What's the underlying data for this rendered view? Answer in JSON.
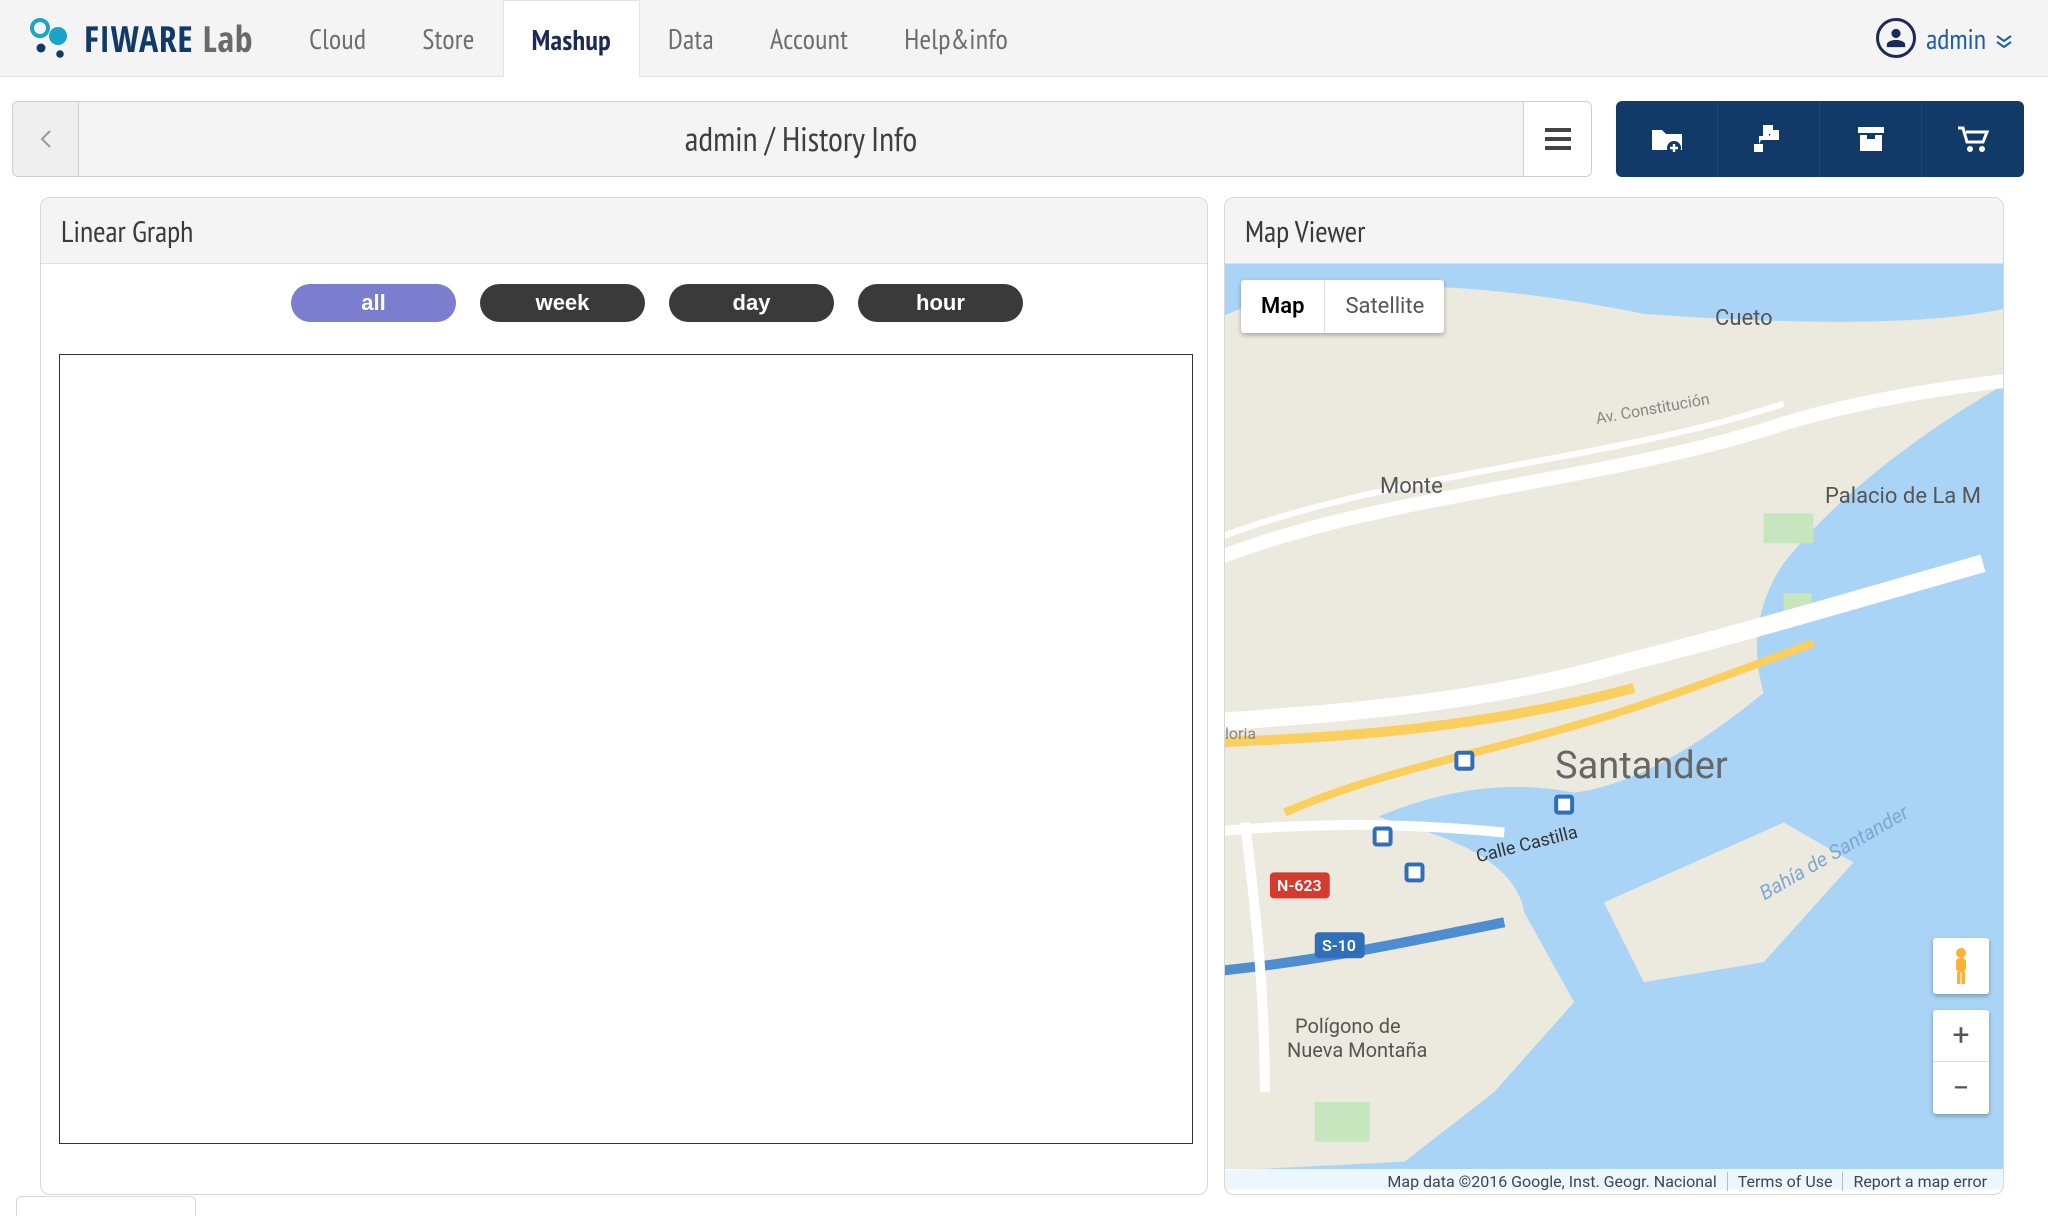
{
  "brand": {
    "name_strong": "FIWARE",
    "name_light": " Lab"
  },
  "nav": {
    "items": [
      {
        "label": "Cloud",
        "active": false
      },
      {
        "label": "Store",
        "active": false
      },
      {
        "label": "Mashup",
        "active": true
      },
      {
        "label": "Data",
        "active": false
      },
      {
        "label": "Account",
        "active": false
      },
      {
        "label": "Help&info",
        "active": false
      }
    ]
  },
  "user": {
    "name": "admin"
  },
  "breadcrumb": {
    "title": "admin / History Info"
  },
  "toolbar_icons": [
    "add-folder-icon",
    "puzzle-icon",
    "archive-icon",
    "cart-icon"
  ],
  "panels": {
    "linear_graph": {
      "title": "Linear Graph",
      "ranges": [
        {
          "label": "all",
          "active": true
        },
        {
          "label": "week",
          "active": false
        },
        {
          "label": "day",
          "active": false
        },
        {
          "label": "hour",
          "active": false
        }
      ]
    },
    "map_viewer": {
      "title": "Map Viewer",
      "types": [
        {
          "label": "Map",
          "active": true
        },
        {
          "label": "Satellite",
          "active": false
        }
      ],
      "labels": {
        "city": "Santander",
        "cueto": "Cueto",
        "monte": "Monte",
        "palacio": "Palacio de La M",
        "poligono1": "Polígono de",
        "poligono2": "Nueva Montaña",
        "constitucion": "Av. Constitución",
        "castilla": "Calle Castilla",
        "oria": "loria",
        "n623": "N-623",
        "s10": "S-10",
        "sea": "Bahía de Santander"
      },
      "attribution": {
        "data": "Map data ©2016 Google, Inst. Geogr. Nacional",
        "terms": "Terms of Use",
        "report": "Report a map error"
      },
      "zoom": {
        "plus": "+",
        "minus": "−"
      }
    }
  }
}
